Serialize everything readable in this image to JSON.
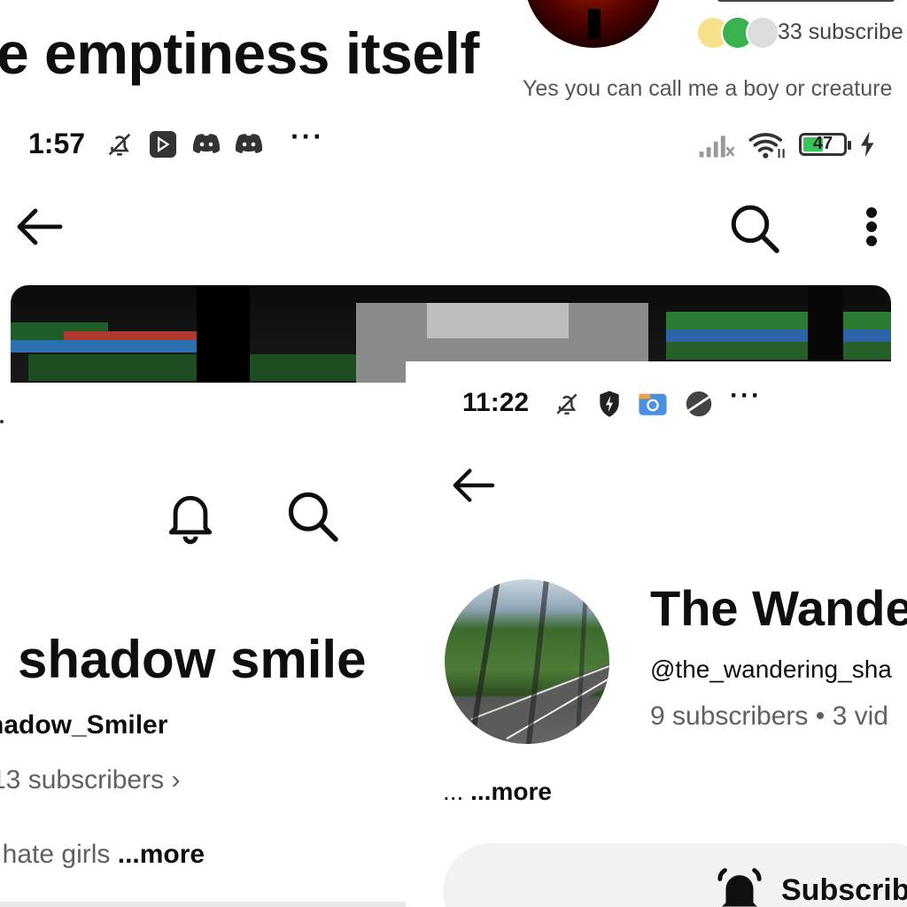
{
  "panel_a": {
    "title": "e emptiness itself"
  },
  "panel_b": {
    "subscribers": "33 subscribe",
    "bio": "Yes you can call me a boy or creature"
  },
  "status_bar_1": {
    "time": "1:57",
    "more": "···",
    "battery": "47"
  },
  "status_bar_2": {
    "time": "11:22",
    "more": "···"
  },
  "panel_d": {
    "name": "shadow smile",
    "handle": "hadow_Smiler",
    "subscribers": "13 subscribers",
    "chevron": "›",
    "bio_text": "/ hate girls ",
    "bio_more": "...more"
  },
  "panel_e": {
    "name": "The Wande",
    "handle": "@the_wandering_sha",
    "stats": "9 subscribers • 3 vid",
    "more_prefix": "... ",
    "more_label": "...more",
    "subscribe_label": "Subscrib"
  },
  "icons": [
    "bell-off-icon",
    "play-box-icon",
    "discord-icon",
    "signal-icon",
    "wifi-icon",
    "battery-icon",
    "charging-icon",
    "back-arrow-icon",
    "search-icon",
    "kebab-icon",
    "shield-icon",
    "files-icon",
    "planet-icon",
    "bell-icon"
  ],
  "colors": {
    "text": "#0f0f0f",
    "secondary": "#606060",
    "battery_fill": "#35c759",
    "button_bg": "#f2f2f2"
  }
}
